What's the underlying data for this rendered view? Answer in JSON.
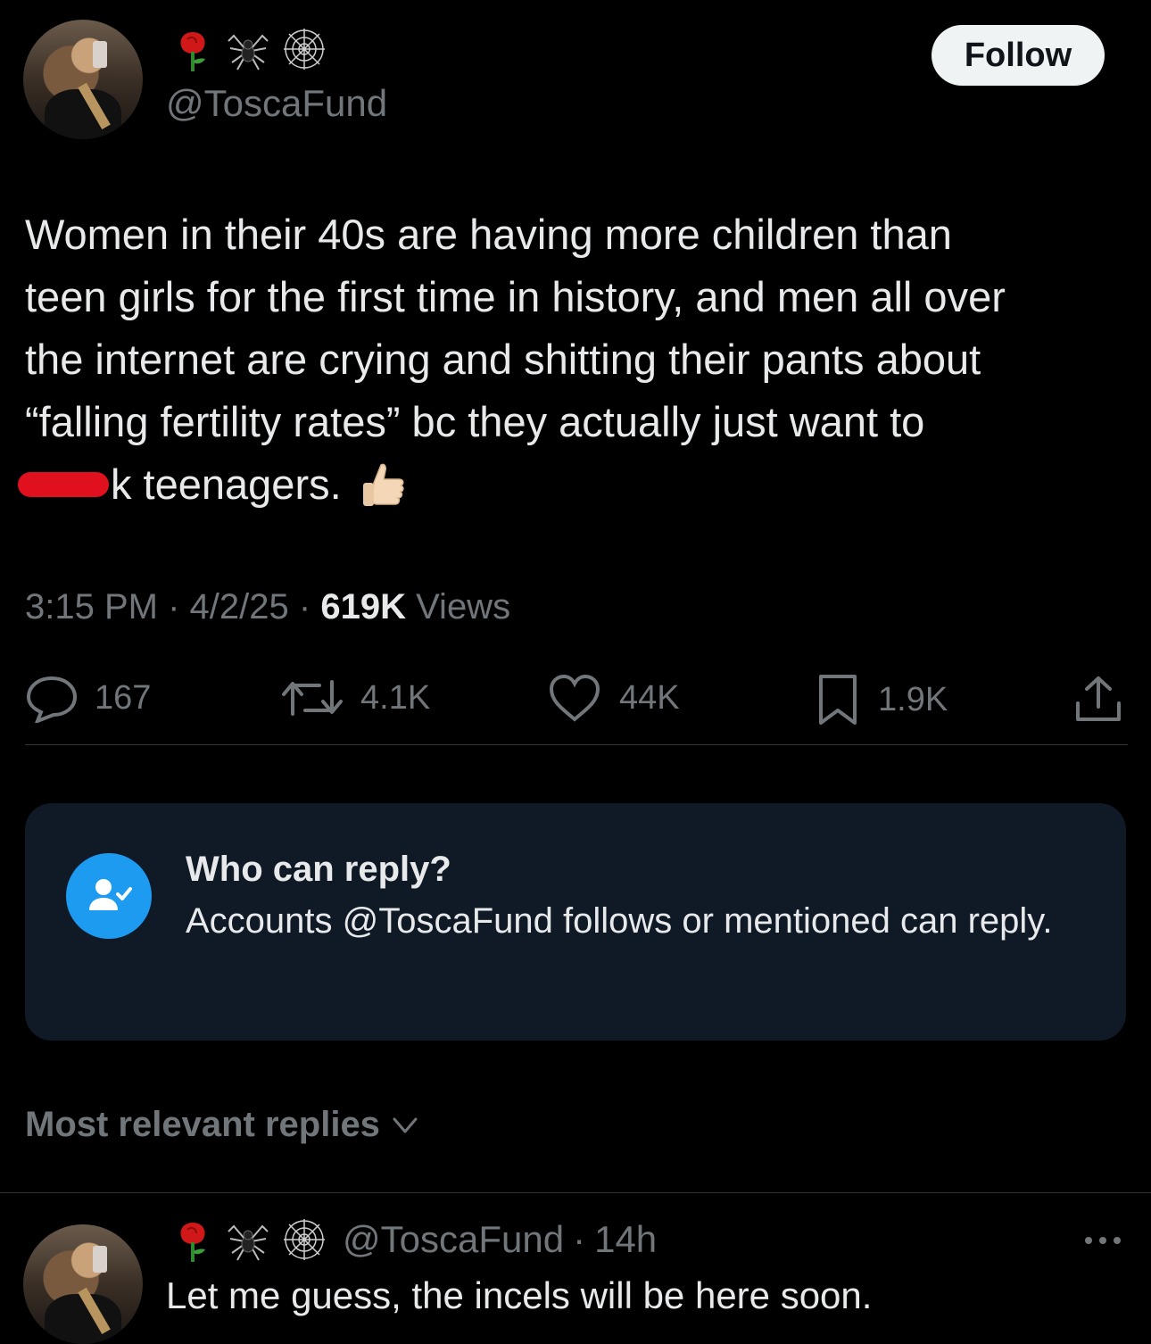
{
  "tweet": {
    "handle": "@ToscaFund",
    "name_emojis": [
      "rose-icon",
      "spider-icon",
      "spider-web-icon"
    ],
    "follow_label": "Follow",
    "text_lines": [
      "Women in their 40s are having more children than",
      "teen girls for the first time in history, and men all over",
      "the internet are crying and shitting their pants about",
      "“falling fertility rates” bc they actually just want to",
      "k teenagers."
    ],
    "thumbs_emoji": "thumbs-up-icon",
    "time": "3:15 PM",
    "date": "4/2/25",
    "views_count": "619K",
    "views_label": "Views",
    "sep": "·"
  },
  "actions": {
    "replies": "167",
    "reposts": "4.1K",
    "likes": "44K",
    "bookmarks": "1.9K"
  },
  "reply_restriction": {
    "title": "Who can reply?",
    "body": "Accounts @ToscaFund follows or mentioned can reply."
  },
  "replies_sort": {
    "label": "Most relevant replies"
  },
  "first_reply": {
    "handle": "@ToscaFund",
    "sep": "·",
    "age": "14h",
    "text": "Let me guess, the incels will be here soon."
  },
  "colors": {
    "background": "#000000",
    "text": "#e7e9ea",
    "muted": "#71767b",
    "accent": "#1d9bf0",
    "card": "#0f1a26",
    "follow_bg": "#eff3f4",
    "redaction": "#e0101e"
  }
}
